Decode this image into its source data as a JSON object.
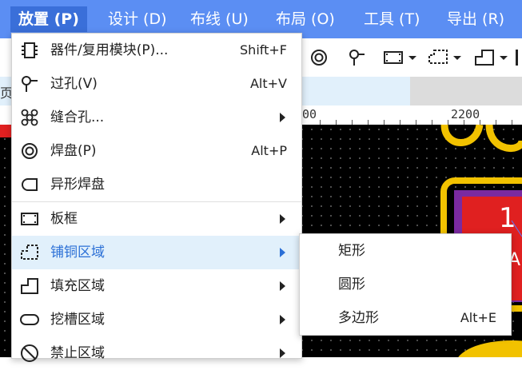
{
  "menubar": {
    "items": [
      "放置 (P)",
      "设计 (D)",
      "布线 (U)",
      "布局 (O)",
      "工具 (T)",
      "导出 (R)"
    ]
  },
  "tab_fragment": "页",
  "ruler": {
    "label_1": "00",
    "label_2": "2200"
  },
  "canvas": {
    "pad_number": "1"
  },
  "dropdown": {
    "items": [
      {
        "label": "器件/复用模块(P)...",
        "shortcut": "Shift+F",
        "icon": "component-icon"
      },
      {
        "label": "过孔(V)",
        "shortcut": "Alt+V",
        "icon": "via-icon"
      },
      {
        "label": "缝合孔...",
        "shortcut": "",
        "icon": "stitching-via-icon"
      },
      {
        "label": "焊盘(P)",
        "shortcut": "Alt+P",
        "icon": "pad-icon"
      },
      {
        "label": "异形焊盘",
        "shortcut": "",
        "icon": "custom-pad-icon"
      },
      {
        "label": "板框",
        "shortcut": "",
        "icon": "board-outline-icon"
      },
      {
        "label": "铺铜区域",
        "shortcut": "",
        "icon": "copper-pour-icon"
      },
      {
        "label": "填充区域",
        "shortcut": "",
        "icon": "fill-region-icon"
      },
      {
        "label": "挖槽区域",
        "shortcut": "",
        "icon": "slot-region-icon"
      },
      {
        "label": "禁止区域",
        "shortcut": "",
        "icon": "prohibited-region-icon"
      }
    ]
  },
  "submenu": {
    "items": [
      {
        "label": "矩形",
        "shortcut": ""
      },
      {
        "label": "圆形",
        "shortcut": ""
      },
      {
        "label": "多边形",
        "shortcut": "Alt+E"
      }
    ]
  },
  "colors": {
    "menubar": "#5b8ef3",
    "menubar_active": "#3a6fd9",
    "highlight_bg": "#e1f0fb",
    "highlight_text": "#2a6fd6",
    "pcb_background": "#000000",
    "pad_red": "#e02020",
    "silkscreen_yellow": "#f2c200"
  }
}
